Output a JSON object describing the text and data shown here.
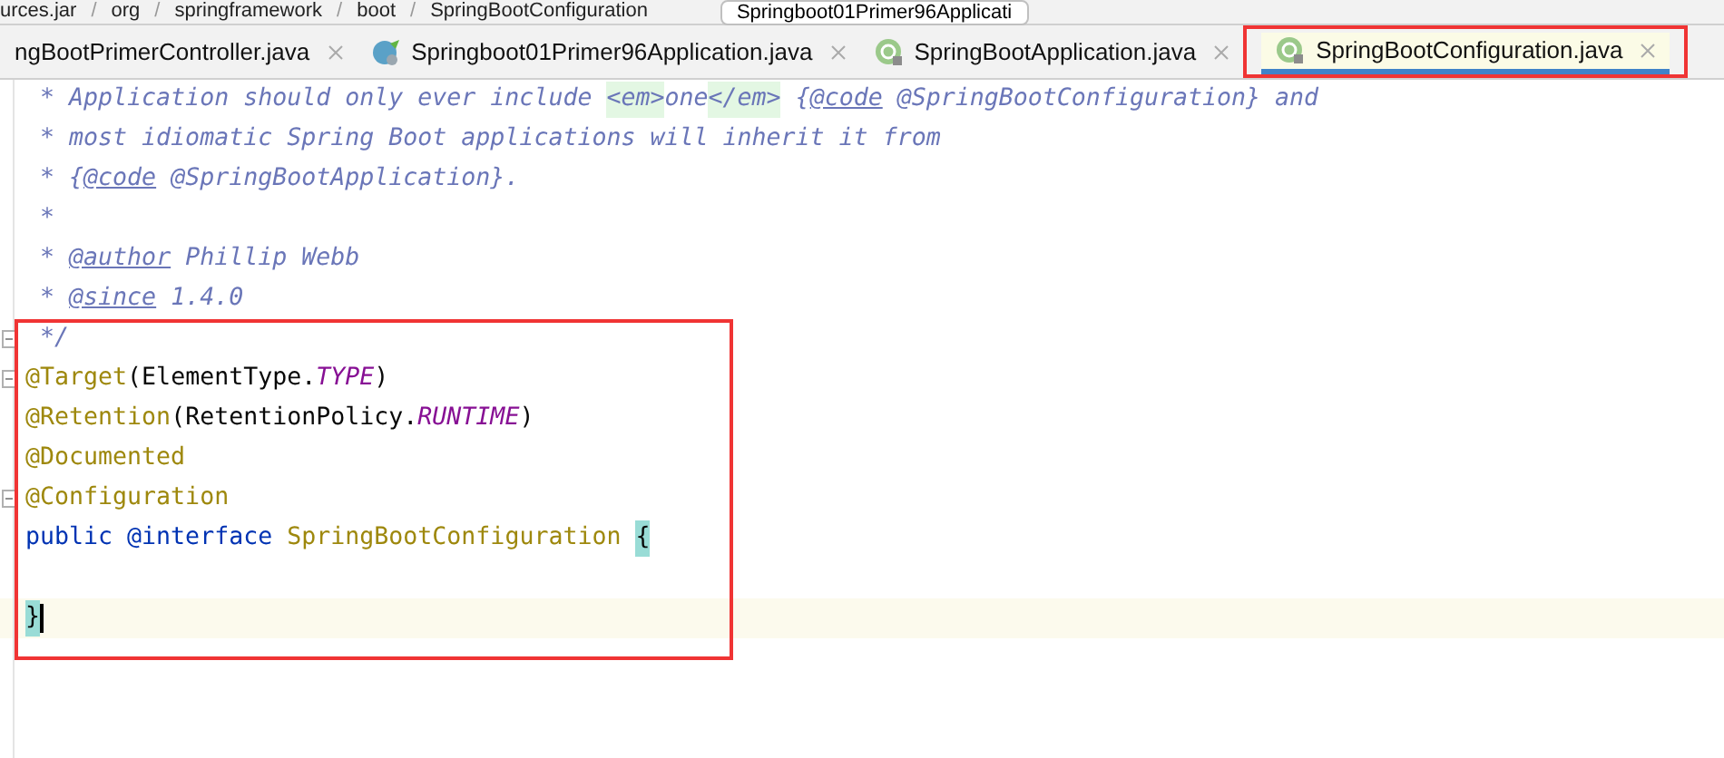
{
  "breadcrumbs": [
    {
      "kind": "item",
      "text": "urces.jar"
    },
    {
      "kind": "separator",
      "text": "/"
    },
    {
      "kind": "item",
      "text": "org"
    },
    {
      "kind": "separator",
      "text": "/"
    },
    {
      "kind": "item",
      "text": "springframework"
    },
    {
      "kind": "separator",
      "text": "/"
    },
    {
      "kind": "item",
      "text": "boot"
    },
    {
      "kind": "separator",
      "text": "/"
    },
    {
      "kind": "item",
      "text": "SpringBootConfiguration"
    }
  ],
  "run_config": {
    "label": "Springboot01Primer96Applicati"
  },
  "tabs": [
    {
      "label": "ngBootPrimerController.java",
      "kind": "plain",
      "selected": false,
      "framed": false
    },
    {
      "label": "Springboot01Primer96Application.java",
      "kind": "spring",
      "selected": false,
      "framed": false
    },
    {
      "label": "SpringBootApplication.java",
      "kind": "annotation",
      "selected": false,
      "framed": false
    },
    {
      "label": "SpringBootConfiguration.java",
      "kind": "annotation",
      "selected": true,
      "framed": true
    }
  ],
  "editor": {
    "blocks": [
      {
        "framed": false,
        "lines": [
          {
            "fold": false,
            "current": false,
            "tokens": [
              {
                "kind": "doc",
                "text": " * Application should only ever include "
              },
              {
                "kind": "html",
                "text": "<em>"
              },
              {
                "kind": "doc",
                "text": "one"
              },
              {
                "kind": "html",
                "text": "</em>"
              },
              {
                "kind": "doc",
                "text": " {"
              },
              {
                "kind": "doctag",
                "text": "@code"
              },
              {
                "kind": "doc",
                "text": " @SpringBootConfiguration} and"
              }
            ]
          },
          {
            "fold": false,
            "current": false,
            "tokens": [
              {
                "kind": "doc",
                "text": " * most idiomatic Spring Boot applications will inherit it from"
              }
            ]
          },
          {
            "fold": false,
            "current": false,
            "tokens": [
              {
                "kind": "doc",
                "text": " * {"
              },
              {
                "kind": "doctag",
                "text": "@code"
              },
              {
                "kind": "doc",
                "text": " @SpringBootApplication}."
              }
            ]
          },
          {
            "fold": false,
            "current": false,
            "tokens": [
              {
                "kind": "doc",
                "text": " *"
              }
            ]
          },
          {
            "fold": false,
            "current": false,
            "tokens": [
              {
                "kind": "doc",
                "text": " * "
              },
              {
                "kind": "doctag",
                "text": "@author"
              },
              {
                "kind": "doc",
                "text": " Phillip Webb"
              }
            ]
          },
          {
            "fold": false,
            "current": false,
            "tokens": [
              {
                "kind": "doc",
                "text": " * "
              },
              {
                "kind": "doctag",
                "text": "@since"
              },
              {
                "kind": "doc",
                "text": " 1.4.0"
              }
            ]
          }
        ]
      },
      {
        "framed": true,
        "lines": [
          {
            "fold": true,
            "current": false,
            "tokens": [
              {
                "kind": "doc",
                "text": " */"
              }
            ]
          },
          {
            "fold": true,
            "current": false,
            "tokens": [
              {
                "kind": "annotation",
                "text": "@Target"
              },
              {
                "kind": "plain",
                "text": "(ElementType."
              },
              {
                "kind": "constant",
                "text": "TYPE"
              },
              {
                "kind": "plain",
                "text": ")"
              }
            ]
          },
          {
            "fold": false,
            "current": false,
            "tokens": [
              {
                "kind": "annotation",
                "text": "@Retention"
              },
              {
                "kind": "plain",
                "text": "(RetentionPolicy."
              },
              {
                "kind": "constant",
                "text": "RUNTIME"
              },
              {
                "kind": "plain",
                "text": ")"
              }
            ]
          },
          {
            "fold": false,
            "current": false,
            "tokens": [
              {
                "kind": "annotation",
                "text": "@Documented"
              }
            ]
          },
          {
            "fold": true,
            "current": false,
            "tokens": [
              {
                "kind": "annotation",
                "text": "@Configuration"
              }
            ]
          },
          {
            "fold": false,
            "current": false,
            "tokens": [
              {
                "kind": "keyword",
                "text": "public @interface "
              },
              {
                "kind": "annotation",
                "text": "SpringBootConfiguration "
              },
              {
                "kind": "brace",
                "text": "{"
              }
            ]
          },
          {
            "fold": false,
            "current": false
          },
          {
            "fold": false,
            "current": true,
            "tokens": [
              {
                "kind": "brace",
                "text": "}"
              }
            ]
          }
        ]
      }
    ]
  }
}
